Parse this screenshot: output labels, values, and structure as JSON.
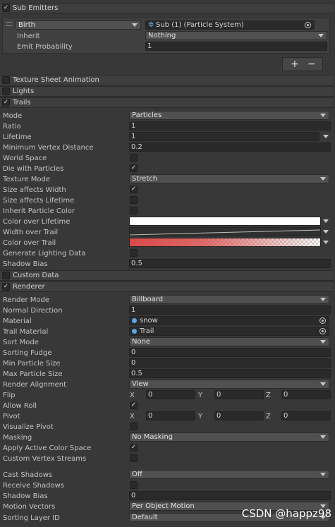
{
  "sub_emitters": {
    "title": "Sub Emitters",
    "enabled": true,
    "entry": {
      "trigger": "Birth",
      "system": "Sub (1) (Particle System)",
      "inherit_label": "Inherit",
      "inherit_value": "Nothing",
      "emit_probability_label": "Emit Probability",
      "emit_probability_value": "1"
    },
    "add_label": "+",
    "remove_label": "−"
  },
  "texture_sheet": {
    "title": "Texture Sheet Animation",
    "enabled": false
  },
  "lights": {
    "title": "Lights",
    "enabled": false
  },
  "trails": {
    "title": "Trails",
    "enabled": true,
    "mode_label": "Mode",
    "mode_value": "Particles",
    "ratio_label": "Ratio",
    "ratio_value": "1",
    "lifetime_label": "Lifetime",
    "lifetime_value": "1",
    "min_vertex_label": "Minimum Vertex Distance",
    "min_vertex_value": "0.2",
    "world_space_label": "World Space",
    "world_space": false,
    "die_label": "Die with Particles",
    "die": true,
    "texture_mode_label": "Texture Mode",
    "texture_mode_value": "Stretch",
    "size_width_label": "Size affects Width",
    "size_width": true,
    "size_lifetime_label": "Size affects Lifetime",
    "size_lifetime": false,
    "inherit_color_label": "Inherit Particle Color",
    "inherit_color": false,
    "color_lifetime_label": "Color over Lifetime",
    "width_trail_label": "Width over Trail",
    "color_trail_label": "Color over Trail",
    "gen_lighting_label": "Generate Lighting Data",
    "gen_lighting": false,
    "shadow_bias_label": "Shadow Bias",
    "shadow_bias_value": "0.5",
    "color_lifetime_hex": "#ffffff",
    "color_trail_hex": "#d94a4a"
  },
  "custom_data": {
    "title": "Custom Data",
    "enabled": false
  },
  "renderer": {
    "title": "Renderer",
    "enabled": true,
    "render_mode_label": "Render Mode",
    "render_mode_value": "Billboard",
    "normal_dir_label": "Normal Direction",
    "normal_dir_value": "1",
    "material_label": "Material",
    "material_value": "snow",
    "trail_material_label": "Trail Material",
    "trail_material_value": "Trail",
    "sort_mode_label": "Sort Mode",
    "sort_mode_value": "None",
    "sorting_fudge_label": "Sorting Fudge",
    "sorting_fudge_value": "0",
    "min_size_label": "Min Particle Size",
    "min_size_value": "0",
    "max_size_label": "Max Particle Size",
    "max_size_value": "0.5",
    "alignment_label": "Render Alignment",
    "alignment_value": "View",
    "flip_label": "Flip",
    "flip": {
      "x": "0",
      "y": "0",
      "z": "0"
    },
    "allow_roll_label": "Allow Roll",
    "allow_roll": true,
    "pivot_label": "Pivot",
    "pivot": {
      "x": "0",
      "y": "0",
      "z": "0"
    },
    "visualize_pivot_label": "Visualize Pivot",
    "visualize_pivot": false,
    "masking_label": "Masking",
    "masking_value": "No Masking",
    "apply_color_label": "Apply Active Color Space",
    "apply_color": true,
    "custom_streams_label": "Custom Vertex Streams",
    "custom_streams": false,
    "cast_shadows_label": "Cast Shadows",
    "cast_shadows_value": "Off",
    "receive_shadows_label": "Receive Shadows",
    "receive_shadows": false,
    "shadow_bias_label": "Shadow Bias",
    "shadow_bias_value": "0",
    "motion_vectors_label": "Motion Vectors",
    "motion_vectors_value": "Per Object Motion",
    "sorting_layer_label": "Sorting Layer ID",
    "sorting_layer_value": "Default"
  },
  "axis": {
    "x": "X",
    "y": "Y",
    "z": "Z"
  },
  "watermark": "CSDN @happz98"
}
